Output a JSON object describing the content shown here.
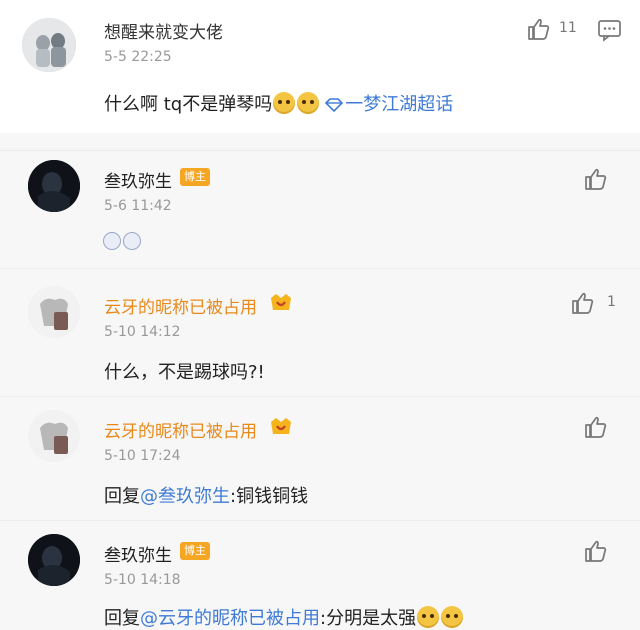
{
  "main_comment": {
    "user": "想醒来就变大佬",
    "time": "5-5 22:25",
    "text": "什么啊  tq不是弹琴吗",
    "topic": "一梦江湖超话",
    "likes": "11"
  },
  "replies": [
    {
      "user": "叁玖弥生",
      "badge": "博主",
      "time": "5-6 11:42",
      "text": ""
    },
    {
      "user": "云牙的昵称已被占用",
      "time": "5-10 14:12",
      "text": "什么，不是踢球吗?!",
      "likes": "1"
    },
    {
      "user": "云牙的昵称已被占用",
      "time": "5-10 17:24",
      "reply_prefix": "回复",
      "mention": "@叁玖弥生",
      "text": ":铜钱铜钱"
    },
    {
      "user": "叁玖弥生",
      "badge": "博主",
      "time": "5-10 14:18",
      "reply_prefix": "回复",
      "mention": "@云牙的昵称已被占用",
      "text": ":分明是太强"
    }
  ]
}
